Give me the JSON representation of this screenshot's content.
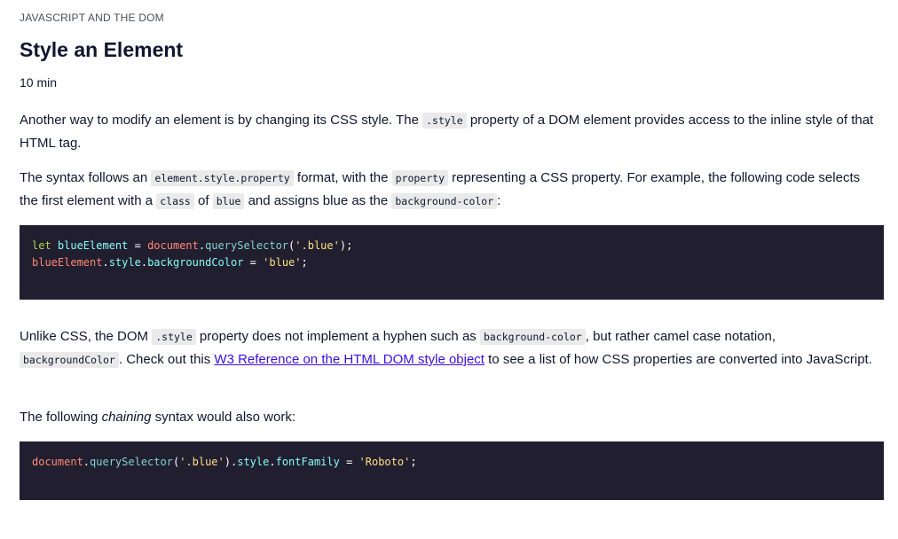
{
  "header": {
    "eyebrow": "JAVASCRIPT AND THE DOM",
    "title": "Style an Element",
    "duration": "10 min"
  },
  "p1": {
    "t1": "Another way to modify an element is by changing its CSS style. The ",
    "c1": ".style",
    "t2": " property of a DOM element provides access to the inline style of that HTML tag."
  },
  "p2": {
    "t1": "The syntax follows an ",
    "c1": "element.style.property",
    "t2": " format, with the ",
    "c2": "property",
    "t3": " representing a CSS property. For example, the following code selects the first element with a ",
    "c3": "class",
    "t4": " of ",
    "c4": "blue",
    "t5": " and assigns blue as the ",
    "c5": "background-color",
    "t6": ":"
  },
  "code1": {
    "l1_kw": "let",
    "l1_var": " blueElement",
    "l1_eq": " = ",
    "l1_obj": "document",
    "l1_dot": ".",
    "l1_fn": "querySelector",
    "l1_p1": "(",
    "l1_str": "'.blue'",
    "l1_p2": ");",
    "l2_obj": "blueElement",
    "l2_dot1": ".",
    "l2_prop1": "style",
    "l2_dot2": ".",
    "l2_prop2": "backgroundColor",
    "l2_eq": " = ",
    "l2_str": "'blue'",
    "l2_end": ";"
  },
  "p3": {
    "t1": "Unlike CSS, the DOM ",
    "c1": ".style",
    "t2": " property does not implement a hyphen such as ",
    "c2": "background-color",
    "t3": ", but rather camel case notation, ",
    "c3": "backgroundColor",
    "t4": ". Check out this ",
    "link": "W3 Reference on the HTML DOM style object",
    "t5": " to see a list of how CSS properties are converted into JavaScript."
  },
  "p4": {
    "t1": "The following ",
    "em": "chaining",
    "t2": " syntax would also work:"
  },
  "code2": {
    "obj": "document",
    "dot1": ".",
    "fn": "querySelector",
    "p1": "(",
    "str1": "'.blue'",
    "p2": ")",
    "dot2": ".",
    "prop1": "style",
    "dot3": ".",
    "prop2": "fontFamily",
    "eq": " = ",
    "str2": "'Roboto'",
    "end": ";"
  }
}
